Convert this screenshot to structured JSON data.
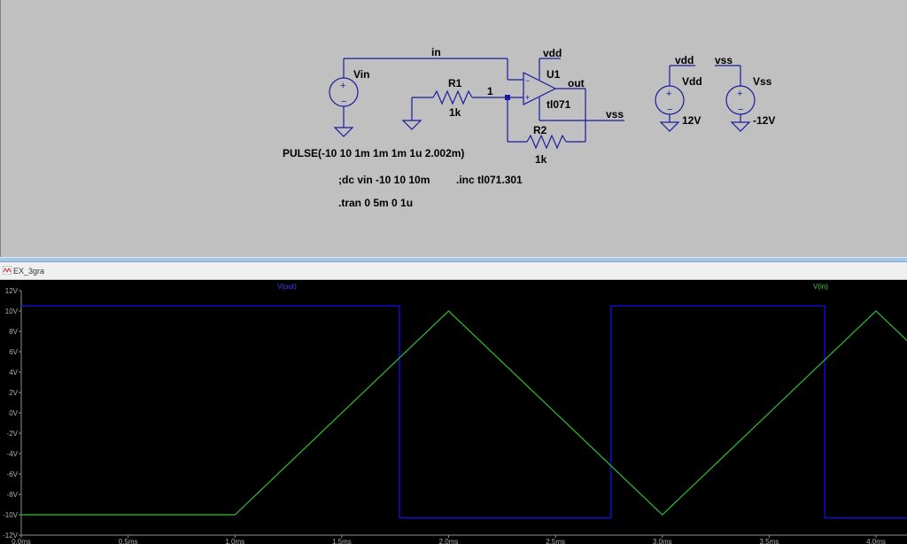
{
  "schematic": {
    "net_in": "in",
    "net_out": "out",
    "net_1": "1",
    "net_vdd_u1": "vdd",
    "net_vss_u1": "vss",
    "net_vdd_src": "vdd",
    "net_vss_src": "vss",
    "vin_name": "Vin",
    "r1_name": "R1",
    "r1_value": "1k",
    "r2_name": "R2",
    "r2_value": "1k",
    "u1_name": "U1",
    "u1_model": "tl071",
    "vdd_name": "Vdd",
    "vdd_value": "12V",
    "vss_name": "Vss",
    "vss_value": "-12V",
    "pulse_directive": "PULSE(-10 10 1m 1m 1m 1u 2.002m)",
    "dc_directive": ";dc vin -10 10 10m",
    "inc_directive": ".inc tl071.301",
    "tran_directive": ".tran 0 5m 0 1u"
  },
  "plot_window": {
    "title": "EX_3gra",
    "trace_out_label": "V(out)",
    "trace_in_label": "V(in)",
    "colors": {
      "background": "#000000",
      "v_out": "#1010ff",
      "v_in": "#30c030",
      "axis_text": "#b0b0b0"
    }
  },
  "chart_data": {
    "type": "line",
    "xlabel": "",
    "ylabel": "",
    "xlim": [
      0,
      4.2
    ],
    "ylim": [
      -12,
      12
    ],
    "x_ticks": [
      "0.0ms",
      "0.5ms",
      "1.0ms",
      "1.5ms",
      "2.0ms",
      "2.5ms",
      "3.0ms",
      "3.5ms",
      "4.0ms"
    ],
    "y_ticks": [
      "12V",
      "10V",
      "8V",
      "6V",
      "4V",
      "2V",
      "0V",
      "-2V",
      "-4V",
      "-6V",
      "-8V",
      "-10V",
      "-12V"
    ],
    "series": [
      {
        "name": "V(out)",
        "x": [
          0,
          1.77,
          1.77,
          2.76,
          2.76,
          3.76,
          3.76,
          4.2
        ],
        "y": [
          10.5,
          10.5,
          -10.3,
          -10.3,
          10.5,
          10.5,
          -10.3,
          -10.3
        ]
      },
      {
        "name": "V(in)",
        "x": [
          0,
          1.0,
          2.0,
          3.0,
          4.0,
          4.2
        ],
        "y": [
          -10,
          -10,
          10,
          -10,
          10,
          6
        ]
      }
    ]
  }
}
